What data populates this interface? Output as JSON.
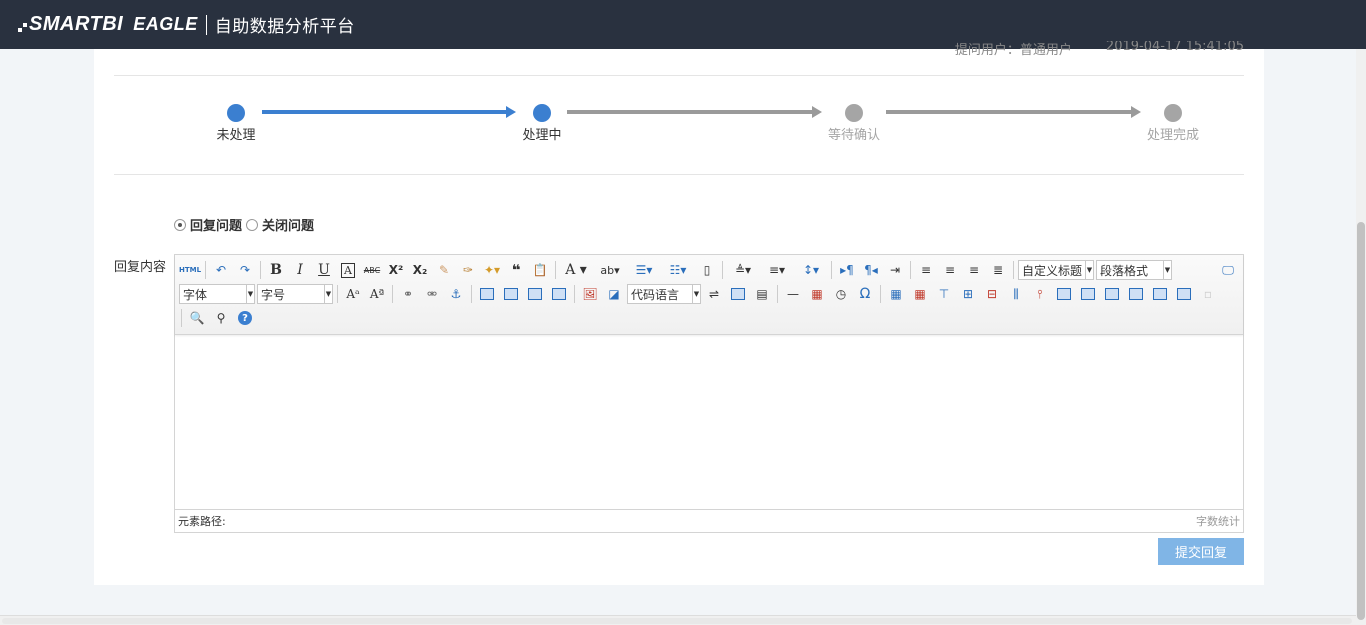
{
  "header": {
    "brand": "SMARTBI",
    "brand_sub": "EAGLE",
    "title": "自助数据分析平台"
  },
  "meta": {
    "submitter": "提问用户：普通用户",
    "time": "2019-04-17 15:41:05"
  },
  "steps": [
    {
      "label": "未处理",
      "state": "active"
    },
    {
      "label": "处理中",
      "state": "active"
    },
    {
      "label": "等待确认",
      "state": "pending"
    },
    {
      "label": "处理完成",
      "state": "pending"
    }
  ],
  "colors": {
    "active": "#3b7fd0",
    "pending": "#a5a5a5",
    "header_bg": "#29313f",
    "submit_bg": "#80b5e6"
  },
  "action": {
    "options": [
      {
        "label": "回复问题",
        "checked": true
      },
      {
        "label": "关闭问题",
        "checked": false
      }
    ]
  },
  "reply": {
    "label": "回复内容",
    "editor": {
      "font_family": "字体",
      "font_size": "字号",
      "code_language": "代码语言",
      "custom_title": "自定义标题",
      "paragraph_format": "段落格式",
      "html_label": "HTML",
      "element_path": "元素路径:",
      "word_count": "字数统计"
    },
    "submit_label": "提交回复"
  }
}
